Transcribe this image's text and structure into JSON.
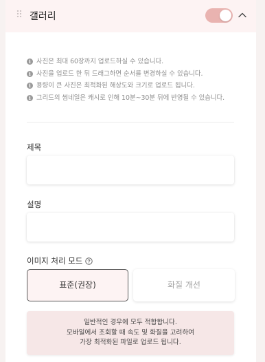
{
  "header": {
    "title": "갤러리",
    "toggle_on": true,
    "accent_color": "#e9b3b0",
    "chevron_icon": "chevron-up-icon",
    "handle_icon": "drag-handle-icon"
  },
  "notes": [
    "사진은 최대 60장까지 업로드하실 수 있습니다.",
    "사진을 업로드 한 뒤 드래그하면 순서를 변경하실 수 있습니다.",
    "용량이 큰 사진은 최적화된 해상도와 크기로 업로드 됩니다.",
    "그리드의 썸네일은 캐시로 인해 10분~30분 뒤에 반영될 수 있습니다."
  ],
  "note_icon": "info-icon",
  "fields": {
    "title_label": "제목",
    "title_value": "",
    "description_label": "설명",
    "description_value": ""
  },
  "mode": {
    "label": "이미지 처리 모드",
    "help_icon": "help-circle-icon",
    "options": [
      "표준(권장)",
      "화질 개선"
    ],
    "selected": "표준(권장)",
    "description": [
      "일반적인 경우에 모두 적합합니다.",
      "모바일에서 조회할 때 속도 및 화질을 고려하여",
      "가장 최적화된 파일로 업로드 됩니다."
    ]
  }
}
